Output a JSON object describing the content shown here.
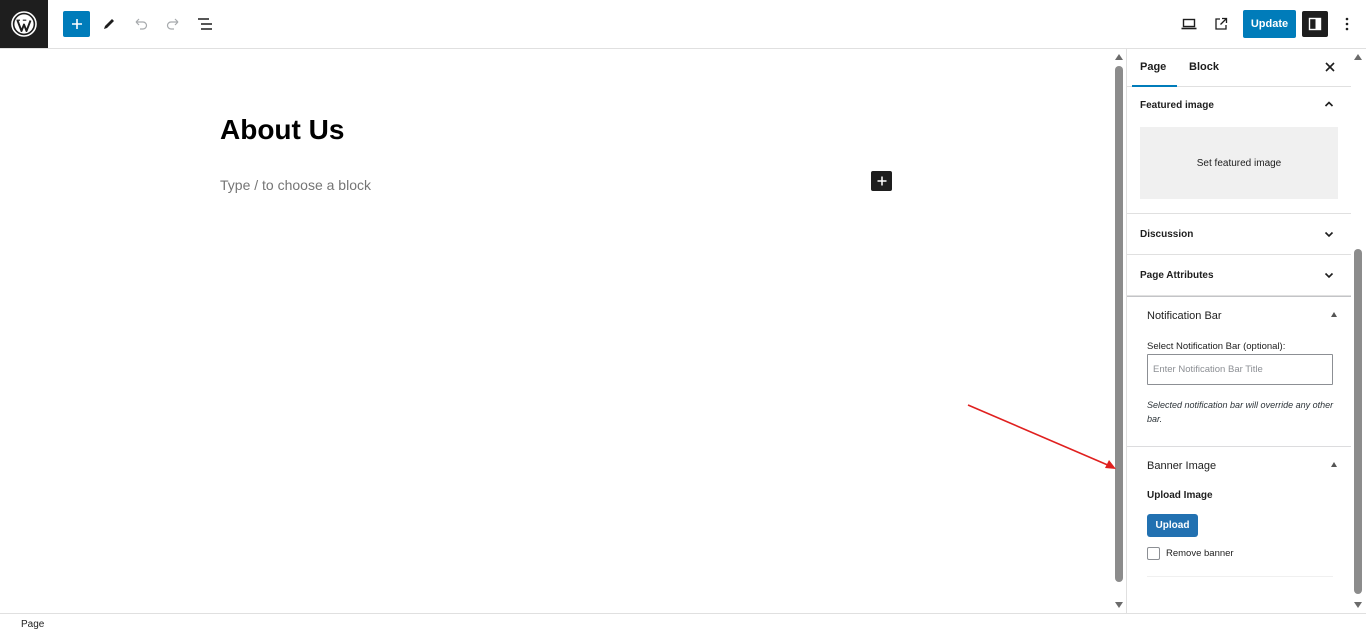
{
  "toolbar": {
    "update_label": "Update"
  },
  "editor": {
    "title": "About Us",
    "block_placeholder": "Type / to choose a block"
  },
  "sidebar": {
    "tabs": [
      {
        "label": "Page",
        "active": true
      },
      {
        "label": "Block",
        "active": false
      }
    ],
    "featured_image": {
      "title": "Featured image",
      "button_label": "Set featured image"
    },
    "discussion_title": "Discussion",
    "page_attributes_title": "Page Attributes",
    "notification_bar": {
      "title": "Notification Bar",
      "field_label": "Select Notification Bar (optional):",
      "placeholder": "Enter Notification Bar Title",
      "help": "Selected notification bar will override any other bar."
    },
    "banner_image": {
      "title": "Banner Image",
      "upload_label": "Upload Image",
      "upload_button": "Upload",
      "remove_label": "Remove banner"
    }
  },
  "footer": {
    "breadcrumb": "Page"
  },
  "colors": {
    "accent": "#007cba",
    "annotation": "#e0201f"
  }
}
